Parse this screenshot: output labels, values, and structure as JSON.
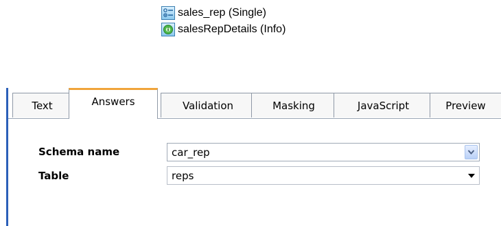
{
  "tree": {
    "items": [
      {
        "label": "sales_rep (Single)",
        "icon": "single-choice-question-icon"
      },
      {
        "label": "salesRepDetails (Info)",
        "icon": "info-item-icon"
      }
    ]
  },
  "tabs": {
    "items": [
      {
        "label": "Text",
        "active": false
      },
      {
        "label": "Answers",
        "active": true
      },
      {
        "label": "Validation",
        "active": false
      },
      {
        "label": "Masking",
        "active": false
      },
      {
        "label": "JavaScript",
        "active": false
      },
      {
        "label": "Preview",
        "active": false
      }
    ],
    "active_accent_color": "#f0a43a"
  },
  "form": {
    "schema_name": {
      "label": "Schema name",
      "value": "car_rep",
      "icon": "chevron-down-icon"
    },
    "table": {
      "label": "Table",
      "value": "reps",
      "icon": "caret-down-icon"
    }
  },
  "colors": {
    "panel_border": "#2a5fb8",
    "tab_border": "#8e98a6"
  }
}
